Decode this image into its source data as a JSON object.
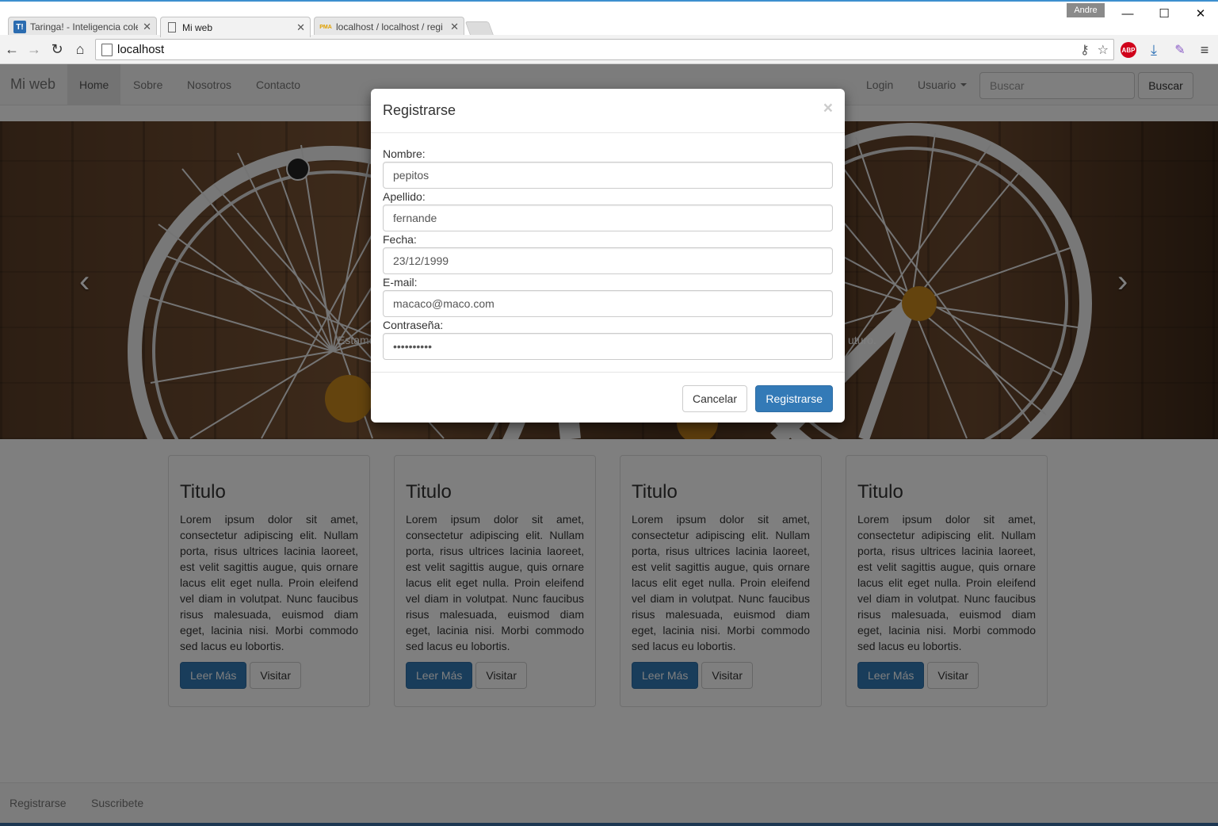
{
  "browser": {
    "tabs": [
      {
        "title": "Taringa! - Inteligencia cole",
        "favicon": "T!"
      },
      {
        "title": "Mi web",
        "favicon": "page-icon"
      },
      {
        "title": "localhost / localhost / regi",
        "favicon": "PMA"
      }
    ],
    "profile": "Andre",
    "url": "localhost"
  },
  "nav": {
    "brand": "Mi web",
    "links": [
      "Home",
      "Sobre",
      "Nosotros",
      "Contacto"
    ],
    "login": "Login",
    "user": "Usuario",
    "search_placeholder": "Buscar",
    "search_button": "Buscar"
  },
  "carousel": {
    "prev_icon": "‹",
    "next_icon": "›",
    "caption_left": "Estamo",
    "caption_right": "uturo."
  },
  "cards": [
    {
      "title": "Titulo",
      "text": "Lorem ipsum dolor sit amet, consectetur adipiscing elit. Nullam porta, risus ultrices lacinia laoreet, est velit sagittis augue, quis ornare lacus elit eget nulla. Proin eleifend vel diam in volutpat. Nunc faucibus risus malesuada, euismod diam eget, lacinia nisi. Morbi commodo sed lacus eu lobortis.",
      "more": "Leer Más",
      "visit": "Visitar"
    },
    {
      "title": "Titulo",
      "text": "Lorem ipsum dolor sit amet, consectetur adipiscing elit. Nullam porta, risus ultrices lacinia laoreet, est velit sagittis augue, quis ornare lacus elit eget nulla. Proin eleifend vel diam in volutpat. Nunc faucibus risus malesuada, euismod diam eget, lacinia nisi. Morbi commodo sed lacus eu lobortis.",
      "more": "Leer Más",
      "visit": "Visitar"
    },
    {
      "title": "Titulo",
      "text": "Lorem ipsum dolor sit amet, consectetur adipiscing elit. Nullam porta, risus ultrices lacinia laoreet, est velit sagittis augue, quis ornare lacus elit eget nulla. Proin eleifend vel diam in volutpat. Nunc faucibus risus malesuada, euismod diam eget, lacinia nisi. Morbi commodo sed lacus eu lobortis.",
      "more": "Leer Más",
      "visit": "Visitar"
    },
    {
      "title": "Titulo",
      "text": "Lorem ipsum dolor sit amet, consectetur adipiscing elit. Nullam porta, risus ultrices lacinia laoreet, est velit sagittis augue, quis ornare lacus elit eget nulla. Proin eleifend vel diam in volutpat. Nunc faucibus risus malesuada, euismod diam eget, lacinia nisi. Morbi commodo sed lacus eu lobortis.",
      "more": "Leer Más",
      "visit": "Visitar"
    }
  ],
  "footer": {
    "links": [
      "Registrarse",
      "Suscribete"
    ]
  },
  "modal": {
    "title": "Registrarse",
    "close": "×",
    "fields": [
      {
        "label": "Nombre:",
        "value": "pepitos"
      },
      {
        "label": "Apellido:",
        "value": "fernande"
      },
      {
        "label": "Fecha:",
        "value": "23/12/1999"
      },
      {
        "label": "E-mail:",
        "value": "macaco@maco.com"
      },
      {
        "label": "Contraseña:",
        "value": "••••••••••"
      }
    ],
    "cancel": "Cancelar",
    "submit": "Registrarse"
  },
  "colors": {
    "primary": "#337ab7",
    "nav_bg": "#f8f8f8",
    "backdrop": "rgba(0,0,0,0.5)"
  }
}
